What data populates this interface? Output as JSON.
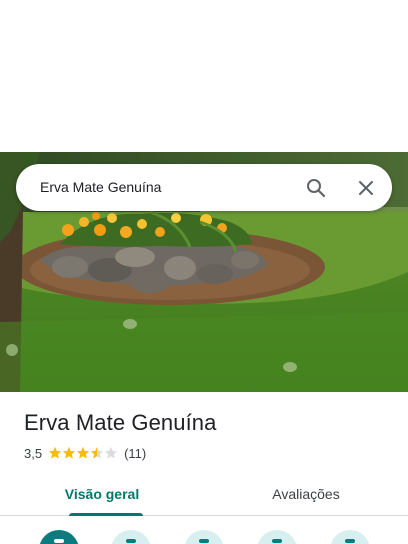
{
  "search": {
    "query": "Erva Mate Genuína",
    "search_icon": "search-icon",
    "close_icon": "close-icon"
  },
  "photo": {
    "subject": "flower-bed-photo"
  },
  "place": {
    "name": "Erva Mate Genuína",
    "rating": "3,5",
    "rating_value": 3.5,
    "rating_max": 5,
    "review_count": "(11)"
  },
  "tabs": [
    {
      "label": "Visão geral",
      "active": true
    },
    {
      "label": "Avaliações",
      "active": false
    }
  ],
  "actions": [
    {
      "icon": "directions-icon",
      "style": "filled"
    },
    {
      "icon": "save-icon",
      "style": "tonal"
    },
    {
      "icon": "nearby-icon",
      "style": "tonal"
    },
    {
      "icon": "send-to-phone-icon",
      "style": "tonal"
    },
    {
      "icon": "share-icon",
      "style": "tonal"
    }
  ],
  "colors": {
    "accent": "#00796b",
    "action_filled": "#0b7b80",
    "action_tonal": "#d8eff0",
    "star": "#fbbc04",
    "star_empty": "#dadce0",
    "text_primary": "#202124",
    "text_secondary": "#3c4043"
  }
}
